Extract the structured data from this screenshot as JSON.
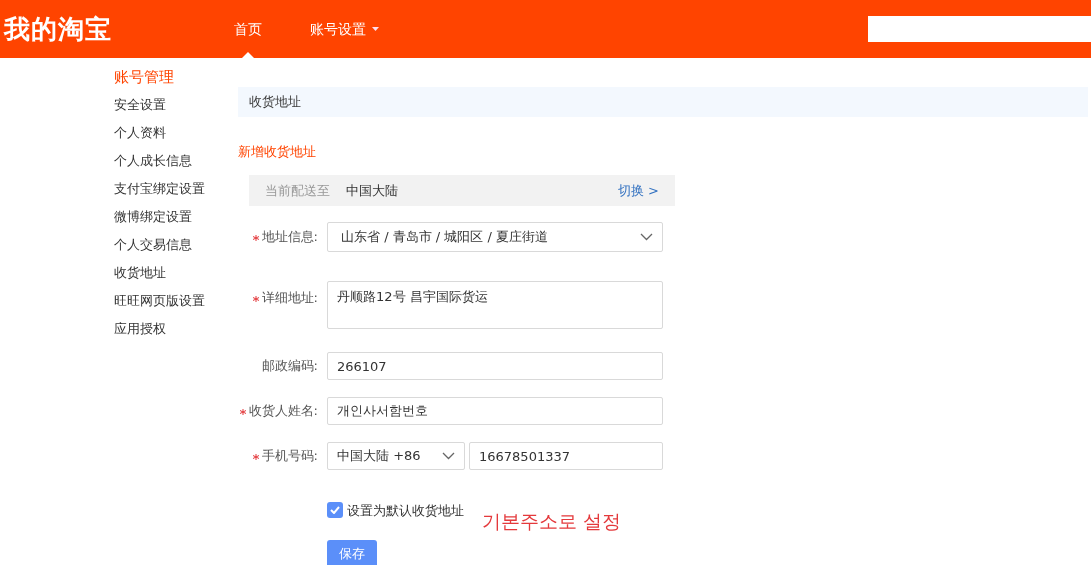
{
  "header": {
    "logo": "我的淘宝",
    "nav": [
      {
        "label": "首页",
        "selected": true,
        "dropdown": false
      },
      {
        "label": "账号设置",
        "selected": false,
        "dropdown": true
      }
    ]
  },
  "sidebar": {
    "title": "账号管理",
    "items": [
      {
        "label": "安全设置"
      },
      {
        "label": "个人资料"
      },
      {
        "label": "个人成长信息"
      },
      {
        "label": "支付宝绑定设置"
      },
      {
        "label": "微博绑定设置"
      },
      {
        "label": "个人交易信息"
      },
      {
        "label": "收货地址"
      },
      {
        "label": "旺旺网页版设置"
      },
      {
        "label": "应用授权"
      }
    ]
  },
  "section_title": "收货地址",
  "add_link": "新增收货地址",
  "region_bar": {
    "label": "当前配送至",
    "value": "中国大陆",
    "switch_link": "切换 >"
  },
  "fields": [
    {
      "kind": "cascader",
      "label": "地址信息:",
      "required": true,
      "value": "山东省 / 青岛市 / 城阳区 / 夏庄街道"
    },
    {
      "kind": "textarea",
      "label": "详细地址:",
      "required": true,
      "value": "丹顺路12号 昌宇国际货运"
    },
    {
      "kind": "input",
      "label": "邮政编码:",
      "required": false,
      "value": "266107"
    },
    {
      "kind": "input",
      "label": "收货人姓名:",
      "required": true,
      "value": "개인사서함번호"
    },
    {
      "kind": "phone",
      "label": "手机号码:",
      "required": true,
      "country": "中国大陆 +86",
      "value": "16678501337"
    }
  ],
  "default_checkbox": {
    "label": "设置为默认收货地址",
    "checked": true
  },
  "annotation": "기본주소로 설정",
  "save_button": "保存"
}
